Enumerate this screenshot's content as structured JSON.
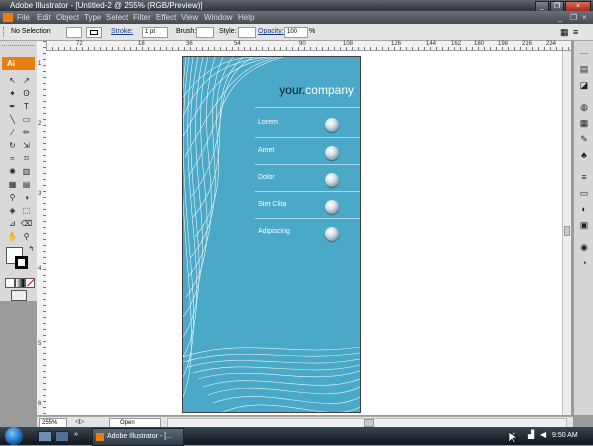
{
  "window": {
    "title": "Adobe Illustrator - [Untitled-2 @ 255% (RGB/Preview)]",
    "minimize_glyph": "_",
    "restore_glyph": "❐",
    "close_glyph": "×"
  },
  "menubar": [
    "File",
    "Edit",
    "Object",
    "Type",
    "Select",
    "Filter",
    "Effect",
    "View",
    "Window",
    "Help"
  ],
  "controlbar": {
    "selection": "No Selection",
    "stroke_label": "Stroke:",
    "stroke_value": "1 pt",
    "brush_label": "Brush:",
    "style_label": "Style:",
    "opacity_label": "Opacity:",
    "opacity_value": "100",
    "opacity_unit": "%"
  },
  "hruler_ticks": [
    "72",
    "18",
    "36",
    "54",
    "90",
    "108",
    "126",
    "144",
    "162",
    "180",
    "198",
    "216",
    "234"
  ],
  "vruler_ticks": [
    "1",
    "2",
    "3",
    "4",
    "5",
    "6"
  ],
  "tools_logo": "Ai",
  "artboard": {
    "brand_prefix": "your.",
    "brand_suffix": "company",
    "items": [
      "Lorem",
      "Amet",
      "Dolor",
      "Stet Clita",
      "Adipiscing"
    ]
  },
  "statusbar": {
    "zoom": "255%",
    "status": "Open"
  },
  "taskbar": {
    "app": "Adobe Illustrator - [...",
    "clock": "9:50 AM"
  },
  "colors": {
    "artboard_bg": "#4aa9c6",
    "ai_orange": "#ea7d10"
  }
}
